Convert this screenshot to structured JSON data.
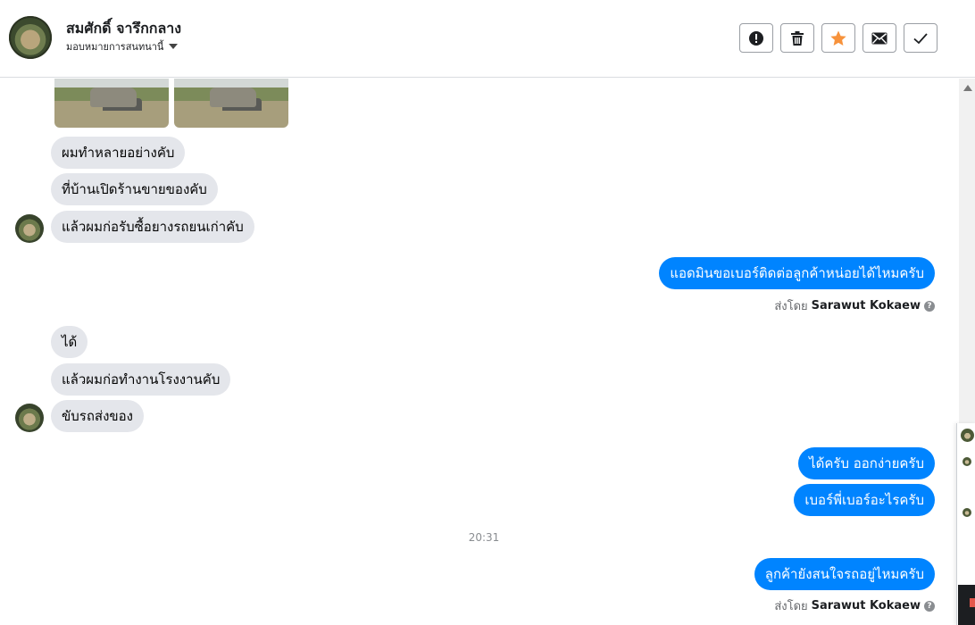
{
  "header": {
    "name": "สมศักดิ์ จารึกกลาง",
    "assign_label": "มอบหมายการสนทนานี้",
    "actions": [
      "report-icon",
      "trash-icon",
      "star-icon",
      "mail-icon",
      "check-icon"
    ],
    "star_color": "#f7923b"
  },
  "messages": {
    "in1": "ผมทำหลายอย่างคับ",
    "in2": "ที่บ้านเปิดร้านขายของคับ",
    "in3": "แล้วผมก่อรับซื้อยางรถยนเก่าคับ",
    "out1": "แอดมินขอเบอร์ติดต่อลูกค้าหน่อยได้ไหมครับ",
    "in4": "ได้",
    "in5": "แล้วผมก่อทำงานโรงงานคับ",
    "in6": "ขับรถส่งของ",
    "out2": "ได้ครับ ออกง่ายครับ",
    "out3": "เบอร์พี่เบอร์อะไรครับ",
    "out4": "ลูกค้ายังสนใจรถอยู่ไหมครับ"
  },
  "sent_by": {
    "prefix": "ส่งโดย",
    "name": "Sarawut Kokaew"
  },
  "timestamp": "20:31",
  "colors": {
    "outgoing": "#0084ff",
    "incoming": "#e4e6eb"
  }
}
